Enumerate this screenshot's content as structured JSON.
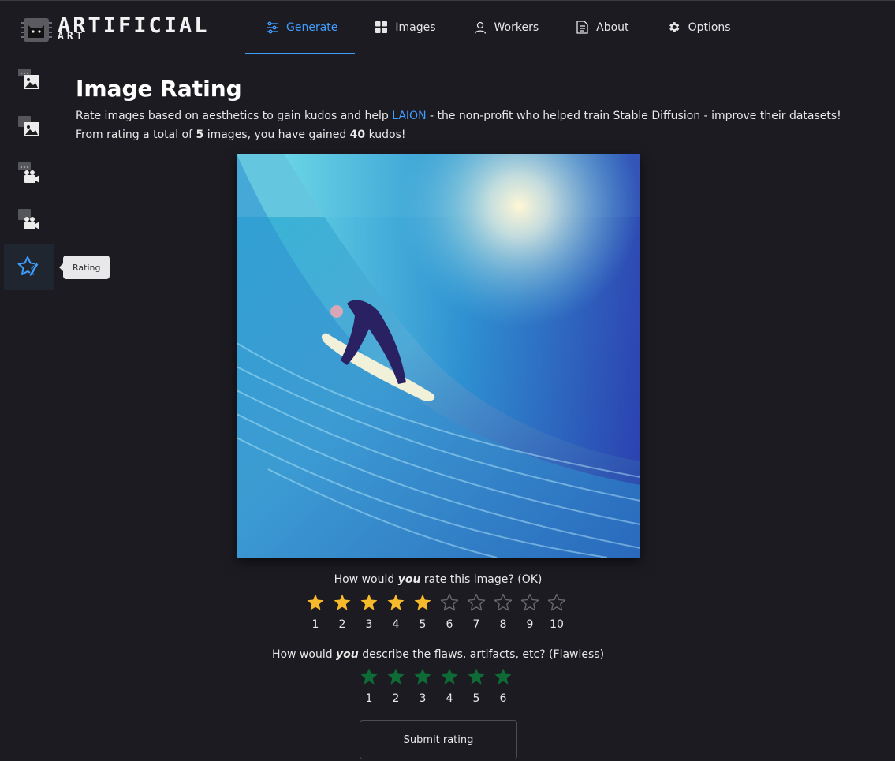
{
  "brand": {
    "title": "ARTIFICIAL",
    "subtitle": "ART"
  },
  "nav": [
    {
      "label": "Generate",
      "icon": "sliders-icon",
      "active": true
    },
    {
      "label": "Images",
      "icon": "grid-icon",
      "active": false
    },
    {
      "label": "Workers",
      "icon": "user-icon",
      "active": false
    },
    {
      "label": "About",
      "icon": "document-icon",
      "active": false
    },
    {
      "label": "Options",
      "icon": "gear-icon",
      "active": false
    }
  ],
  "sidebar": {
    "items": [
      {
        "icon": "text-to-image-icon"
      },
      {
        "icon": "image-to-image-icon"
      },
      {
        "icon": "video-icon"
      },
      {
        "icon": "image-to-video-icon"
      },
      {
        "icon": "rating-star-icon",
        "active": true
      }
    ],
    "tooltip": "Rating"
  },
  "page": {
    "title": "Image Rating",
    "desc_line1_before": "Rate images based on aesthetics to gain kudos and help ",
    "desc_link": "LAION",
    "desc_line1_after": " - the non-profit who helped train Stable Diffusion - improve their datasets!",
    "desc_line2_a": "From rating a total of ",
    "images_rated": "5",
    "desc_line2_b": " images, you have gained ",
    "kudos_gained": "40",
    "desc_line2_c": " kudos!"
  },
  "rating": {
    "q_prefix": "How would ",
    "q_you": "you",
    "q_suffix": " rate this image? (OK)",
    "value": 5,
    "max": 10,
    "labels": [
      "1",
      "2",
      "3",
      "4",
      "5",
      "6",
      "7",
      "8",
      "9",
      "10"
    ],
    "color": "#f7ba2a"
  },
  "artifacts": {
    "q_prefix": "How would ",
    "q_you": "you",
    "q_suffix": " describe the flaws, artifacts, etc? (Flawless)",
    "value": 6,
    "max": 6,
    "labels": [
      "1",
      "2",
      "3",
      "4",
      "5",
      "6"
    ],
    "color": "#0e6b35"
  },
  "submit_label": "Submit rating",
  "colors": {
    "accent": "#409eff",
    "background": "#1c1b22"
  }
}
